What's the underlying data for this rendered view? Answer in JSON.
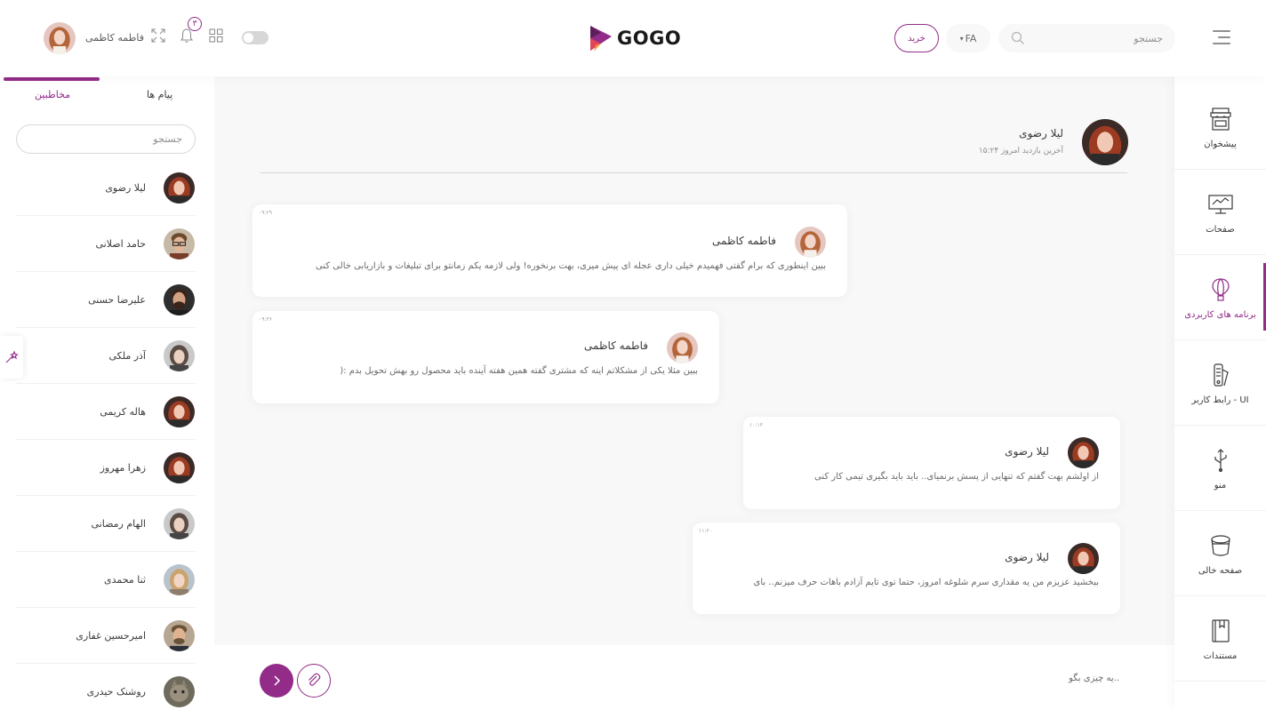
{
  "header": {
    "search_placeholder": "جستجو",
    "language": "FA",
    "buy_label": "خرید",
    "brand": "GOGO",
    "notification_count": "۳",
    "user_name": "فاطمه کاظمی"
  },
  "sidebar": {
    "items": [
      {
        "label": "پیشخوان",
        "icon": "shop-icon"
      },
      {
        "label": "صفحات",
        "icon": "monitor-icon"
      },
      {
        "label": "برنامه های کاربردی",
        "icon": "balloon-icon"
      },
      {
        "label": "رابط کاربر - UI",
        "icon": "pantone-icon"
      },
      {
        "label": "منو",
        "icon": "usb-icon"
      },
      {
        "label": "صفحه خالی",
        "icon": "bucket-icon"
      },
      {
        "label": "مستندات",
        "icon": "book-icon"
      }
    ],
    "active_index": 2
  },
  "panel": {
    "tabs": {
      "contacts": "مخاطبین",
      "messages": "پیام ها"
    },
    "search_placeholder": "جستجو",
    "contacts": [
      {
        "name": "لیلا رضوی"
      },
      {
        "name": "حامد اصلانی"
      },
      {
        "name": "علیرضا حسنی"
      },
      {
        "name": "آذر ملکی"
      },
      {
        "name": "هاله کریمی"
      },
      {
        "name": "زهرا مهروز"
      },
      {
        "name": "الهام رمضانی"
      },
      {
        "name": "ثنا محمدی"
      },
      {
        "name": "امیرحسین غفاری"
      },
      {
        "name": "روشنک حیدری"
      }
    ]
  },
  "chat": {
    "contact_name": "لیلا رضوی",
    "last_seen": "آخرین بازدید امروز ۱۵:۲۴",
    "messages": [
      {
        "time": "۰۹:۲۹",
        "sender": "فاطمه کاظمی",
        "text": "ببین اینطوری که برام گفتی فهمیدم خیلی داری عجله ای پیش میری، بهت برنخوره! ولی لازمه یکم زمانتو برای تبلیغات و بازاریابی خالی کنی"
      },
      {
        "time": "۰۹:۳۶",
        "sender": "فاطمه کاظمی",
        "text": "ببین مثلا یکی از مشکلاتم اینه که مشتری گفته همین هفته آینده باید محصول رو بهش تحویل بدم :("
      },
      {
        "time": "۱۰:۱۳",
        "sender": "لیلا رضوی",
        "text": "از اولشم بهت گفتم که تنهایی از پسش برنمیای.. باید باید بگیری تیمی کار کنی"
      },
      {
        "time": "۱۱:۲۰",
        "sender": "لیلا رضوی",
        "text": "ببخشید عزیزم من یه مقداری سرم شلوغه امروز، حتما توی تایم آزادم باهات حرف میزنم.. بای"
      }
    ],
    "composer_placeholder": "یه چیزی بگو.."
  },
  "colors": {
    "accent": "#922c88",
    "background": "#f8f8f8"
  }
}
